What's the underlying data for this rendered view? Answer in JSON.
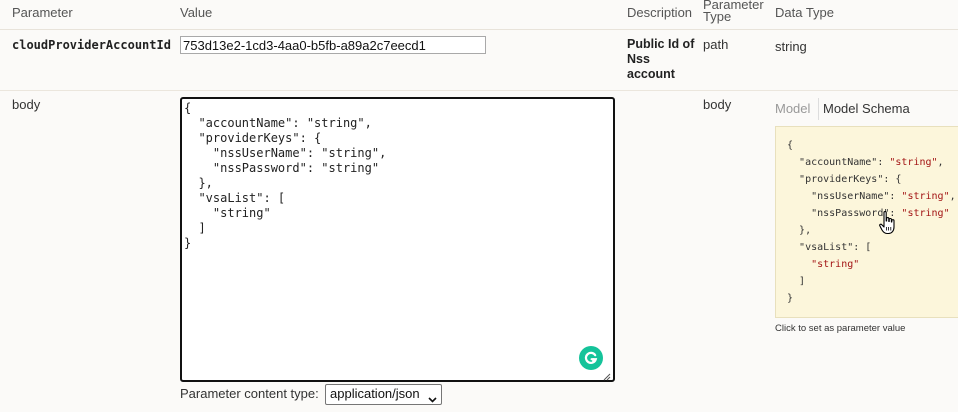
{
  "headers": {
    "parameter": "Parameter",
    "value": "Value",
    "description": "Description",
    "parameter_type": "Parameter Type",
    "data_type": "Data Type"
  },
  "row1": {
    "name": "cloudProviderAccountId",
    "value": "753d13e2-1cd3-4aa0-b5fb-a89a2c7eecd1",
    "description": "Public Id of Nss account",
    "param_type": "path",
    "data_type": "string"
  },
  "row2": {
    "name": "body",
    "json": "{\n  \"accountName\": \"string\",\n  \"providerKeys\": {\n    \"nssUserName\": \"string\",\n    \"nssPassword\": \"string\"\n  },\n  \"vsaList\": [\n    \"string\"\n  ]\n}",
    "param_type": "body",
    "content_type_label": "Parameter content type:",
    "content_type_value": "application/json",
    "model_tab": "Model",
    "schema_tab": "Model Schema",
    "schema": {
      "open": "{",
      "k_accountName": "\"accountName\"",
      "v_accountName": "\"string\"",
      "k_providerKeys": "\"providerKeys\"",
      "open_obj": "{",
      "k_nssUserName": "\"nssUserName\"",
      "v_nssUserName": "\"string\"",
      "k_nssPassword": "\"nssPassword\"",
      "v_nssPassword": "\"string\"",
      "close_obj": "},",
      "k_vsaList": "\"vsaList\"",
      "open_arr": "[",
      "v_vsa": "\"string\"",
      "close_arr": "]",
      "close": "}"
    },
    "hint": "Click to set as parameter value"
  },
  "colors": {
    "accent_grammarly": "#15c39a",
    "schema_bg": "#fcf6db",
    "string_value": "#a31515"
  },
  "icons": {
    "grammarly": "grammarly-icon",
    "cursor": "hand-pointer-icon",
    "chevron": "chevron-down-icon",
    "resize": "resize-handle-icon"
  }
}
